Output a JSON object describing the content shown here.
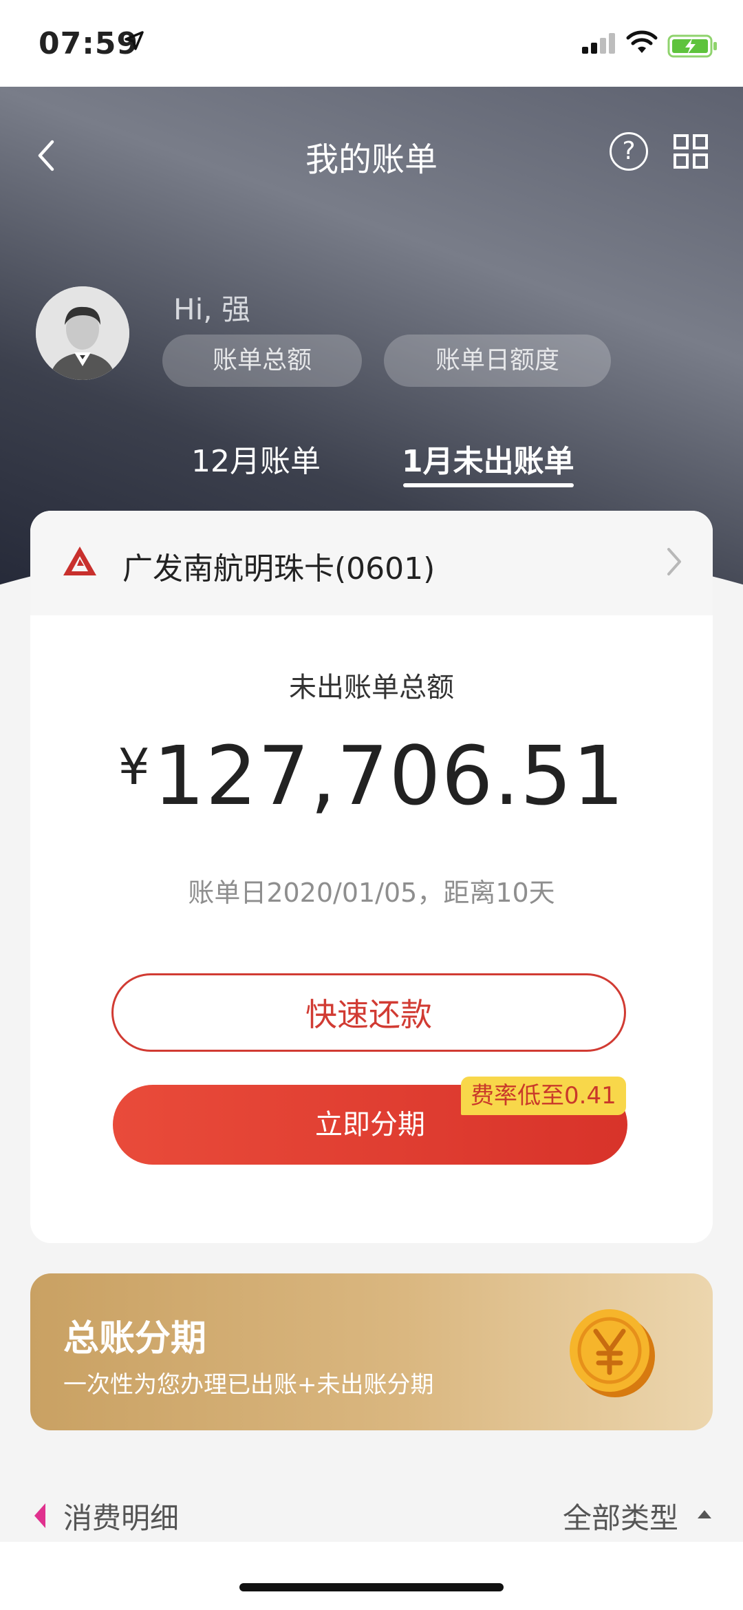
{
  "status_bar": {
    "time": "07:59",
    "icons": [
      "location-arrow-icon",
      "cellular-signal-icon",
      "wifi-icon",
      "battery-charging-icon"
    ]
  },
  "header": {
    "title": "我的账单",
    "icons": [
      "back-chevron-icon",
      "help-question-icon",
      "grid-menu-icon"
    ]
  },
  "profile": {
    "greeting": "Hi, 强",
    "chips": [
      "账单总额",
      "账单日额度"
    ]
  },
  "tabs": [
    {
      "label": "12月账单",
      "selected": false
    },
    {
      "label": "1月未出账单",
      "selected": true
    }
  ],
  "card": {
    "name": "广发南航明珠卡(0601)",
    "amount_label": "未出账单总额",
    "currency_symbol": "¥",
    "amount": "127,706.51",
    "bill_info": "账单日2020/01/05，距离10天",
    "repay_button": "快速还款",
    "installment_button": "立即分期",
    "rate_tag": "费率低至0.41"
  },
  "banner": {
    "title": "总账分期",
    "subtitle": "一次性为您办理已出账+未出账分期"
  },
  "details": {
    "label": "消费明细",
    "filter": "全部类型"
  },
  "colors": {
    "accent_red": "#d13b33",
    "tag_yellow": "#f8d74a",
    "banner_gold": "#d4ae74"
  }
}
